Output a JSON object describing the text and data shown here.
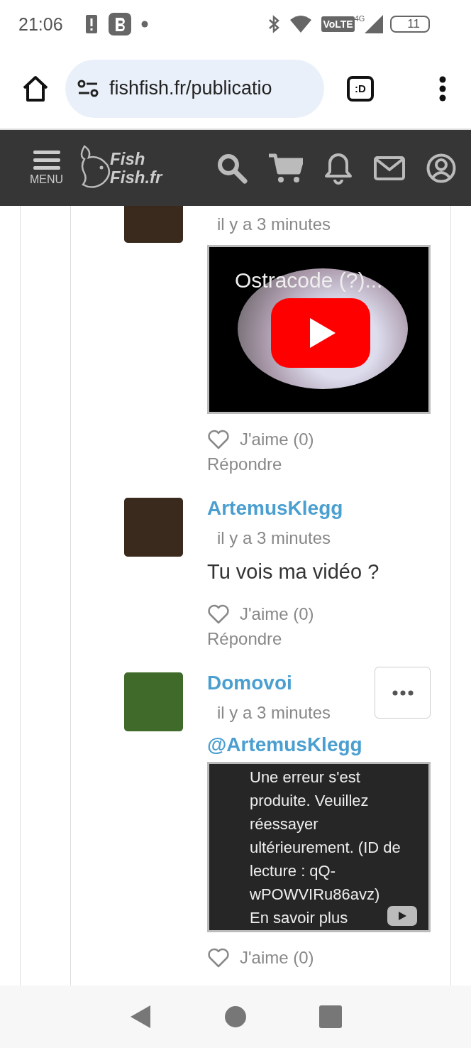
{
  "status_bar": {
    "time": "21:06",
    "volte": "VoLTE",
    "network": "4G",
    "battery": "11"
  },
  "browser": {
    "url": "fishfish.fr/publicatio",
    "tab_label": ":D"
  },
  "site_header": {
    "menu_label": "MENU",
    "logo_line_1": "Fish",
    "logo_line_2": "Fish.fr"
  },
  "thread": [
    {
      "kind": "comment",
      "color": "#3a2a1e",
      "time": "il y a 3 minutes",
      "has_menu": false,
      "content": [
        {
          "kind": "video",
          "title": "Ostracode (?)..."
        }
      ],
      "like_label": "J'aime (0)",
      "reply_label": "Répondre"
    },
    {
      "kind": "comment",
      "author": "ArtemusKlegg",
      "color": "#3a2a1e",
      "time": "il y a 3 minutes",
      "has_menu": false,
      "content": [
        {
          "kind": "text",
          "text": "Tu vois ma vidéo ?"
        }
      ],
      "like_label": "J'aime (0)",
      "reply_label": "Répondre"
    },
    {
      "kind": "comment",
      "author": "Domovoi",
      "color": "#3f6a2a",
      "time": "il y a 3 minutes",
      "has_menu": true,
      "content": [
        {
          "kind": "mention",
          "text": "@ArtemusKlegg"
        },
        {
          "kind": "video_error",
          "message": "Une erreur s'est produite. Veuillez réessayer ultérieurement. (ID de lecture : qQ-wPOWVIRu86avz)",
          "link": "En savoir plus"
        }
      ],
      "like_label": "J'aime (0)"
    }
  ]
}
